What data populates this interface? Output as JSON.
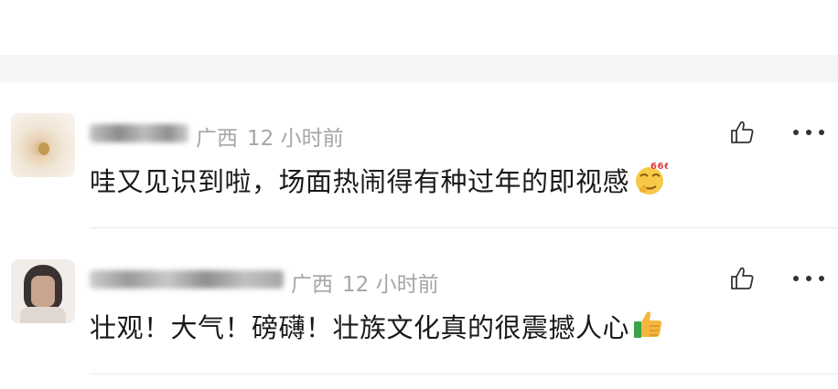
{
  "colors": {
    "background": "#ffffff",
    "separator": "#f5f5f5",
    "meta_text": "#a6a6a6",
    "body_text": "#1a1a1a",
    "divider": "#e9e9e9"
  },
  "comments": [
    {
      "username": "",
      "region": "广西",
      "time": "12 小时前",
      "text": "哇又见识到啦，场面热闹得有种过年的即视感",
      "emoji_icon": "666-emoji-icon",
      "emoji_text": "666"
    },
    {
      "username": "",
      "region": "广西",
      "time": "12 小时前",
      "text": "壮观！大气！磅礴！壮族文化真的很震撼人心",
      "emoji_icon": "thumbs-up-emoji-icon"
    }
  ]
}
